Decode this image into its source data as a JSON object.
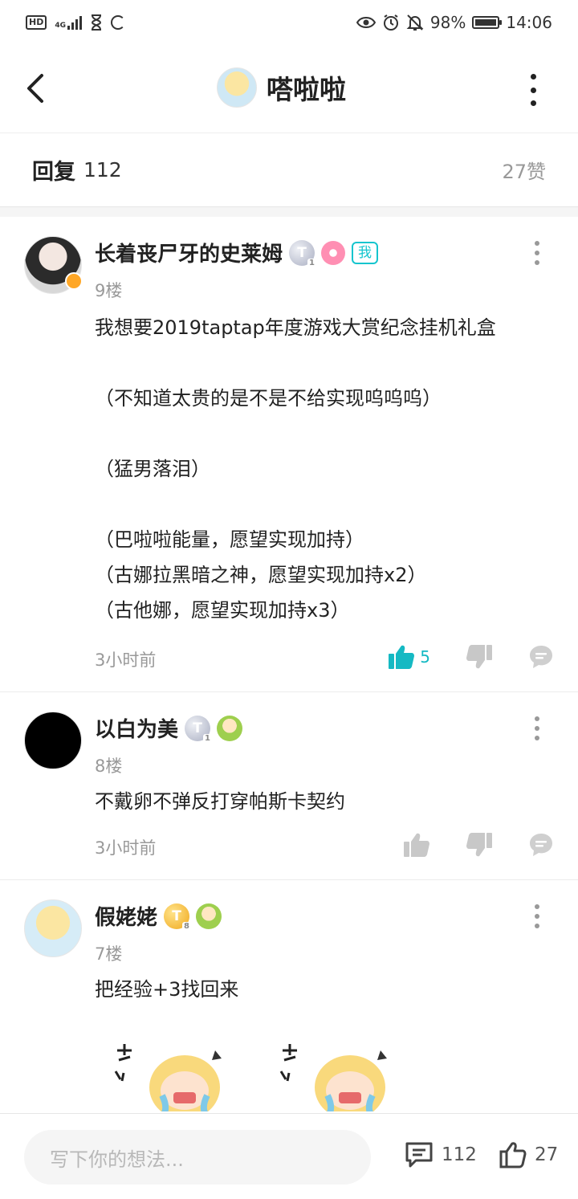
{
  "status_bar": {
    "hd": "HD",
    "network": "4G",
    "battery": "98%",
    "time": "14:06"
  },
  "header": {
    "title": "嗒啦啦"
  },
  "replies_bar": {
    "label": "回复",
    "count": "112",
    "likes": "27赞"
  },
  "comments": [
    {
      "name": "长着丧尸牙的史莱姆",
      "badge_me": "我",
      "floor": "9楼",
      "body": "我想要2019taptap年度游戏大赏纪念挂机礼盒\n\n（不知道太贵的是不是不给实现呜呜呜）\n\n（猛男落泪）\n\n（巴啦啦能量，愿望实现加持）\n（古娜拉黑暗之神，愿望实现加持x2）\n（古他娜，愿望实现加持x3）",
      "time": "3小时前",
      "likes": "5"
    },
    {
      "name": "以白为美",
      "floor": "8楼",
      "body": "不戴卵不弹反打穿帕斯卡契约",
      "time": "3小时前"
    },
    {
      "name": "假姥姥",
      "floor": "7楼",
      "body": "把经验+3找回来"
    }
  ],
  "bottom_bar": {
    "placeholder": "写下你的想法...",
    "comment_count": "112",
    "like_count": "27"
  },
  "colors": {
    "accent": "#15c5ce",
    "like_active": "#15b9c3",
    "muted": "#999999"
  }
}
